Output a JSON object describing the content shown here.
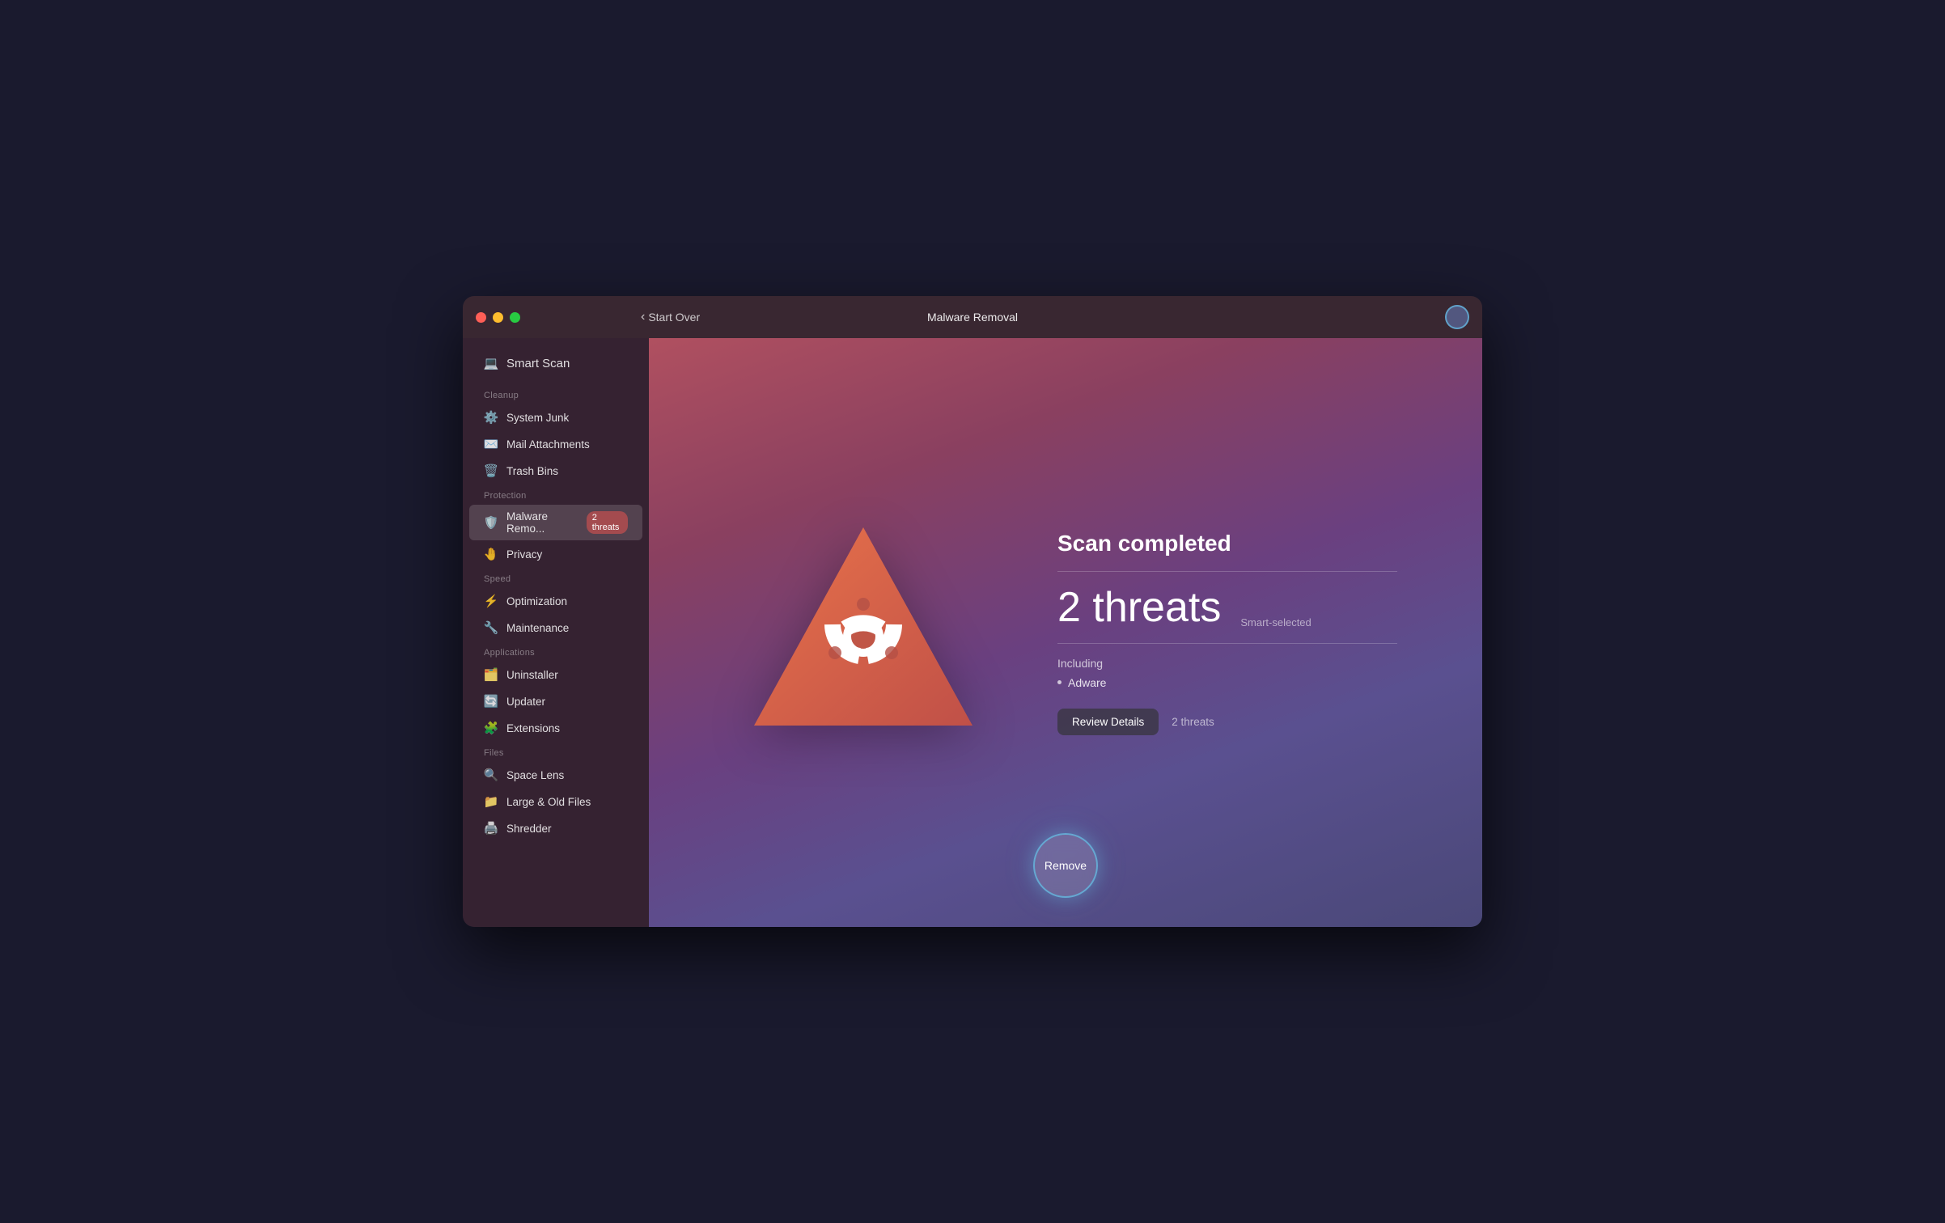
{
  "window": {
    "title": "Malware Removal",
    "back_label": "Start Over"
  },
  "traffic_lights": {
    "close": "close",
    "minimize": "minimize",
    "maximize": "maximize"
  },
  "sidebar": {
    "smart_scan_label": "Smart Scan",
    "sections": [
      {
        "label": "Cleanup",
        "items": [
          {
            "id": "system-junk",
            "label": "System Junk",
            "icon": "⚙️"
          },
          {
            "id": "mail-attachments",
            "label": "Mail Attachments",
            "icon": "✉️"
          },
          {
            "id": "trash-bins",
            "label": "Trash Bins",
            "icon": "🗑️"
          }
        ]
      },
      {
        "label": "Protection",
        "items": [
          {
            "id": "malware-removal",
            "label": "Malware Remo...",
            "icon": "🛡️",
            "badge": "2 threats",
            "active": true
          },
          {
            "id": "privacy",
            "label": "Privacy",
            "icon": "🤚"
          }
        ]
      },
      {
        "label": "Speed",
        "items": [
          {
            "id": "optimization",
            "label": "Optimization",
            "icon": "⚡"
          },
          {
            "id": "maintenance",
            "label": "Maintenance",
            "icon": "🔧"
          }
        ]
      },
      {
        "label": "Applications",
        "items": [
          {
            "id": "uninstaller",
            "label": "Uninstaller",
            "icon": "🗂️"
          },
          {
            "id": "updater",
            "label": "Updater",
            "icon": "🔄"
          },
          {
            "id": "extensions",
            "label": "Extensions",
            "icon": "🧩"
          }
        ]
      },
      {
        "label": "Files",
        "items": [
          {
            "id": "space-lens",
            "label": "Space Lens",
            "icon": "🔍"
          },
          {
            "id": "large-old-files",
            "label": "Large & Old Files",
            "icon": "📁"
          },
          {
            "id": "shredder",
            "label": "Shredder",
            "icon": "🖨️"
          }
        ]
      }
    ]
  },
  "main": {
    "scan_completed_label": "Scan completed",
    "threats_count": "2 threats",
    "smart_selected_label": "Smart-selected",
    "including_label": "Including",
    "threat_items": [
      "Adware"
    ],
    "review_details_label": "Review Details",
    "review_threats_label": "2 threats",
    "remove_label": "Remove"
  }
}
